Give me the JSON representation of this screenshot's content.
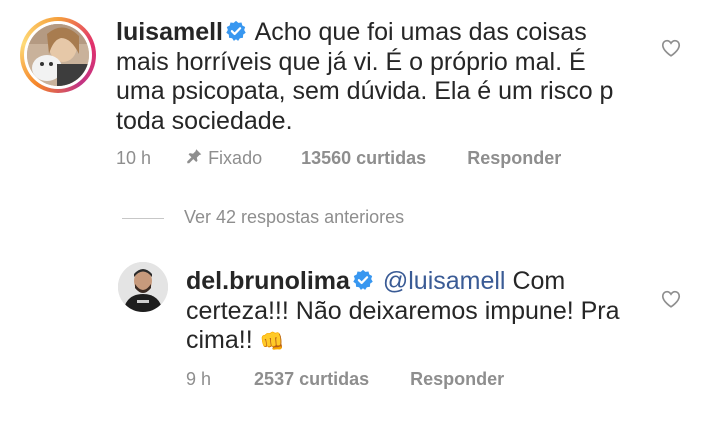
{
  "comment1": {
    "username": "luisamell",
    "text": "Acho que foi umas das coisas mais horríveis que já vi. É o próprio mal. É uma psicopata, sem dúvida. Ela é um risco p toda sociedade.",
    "time": "10 h",
    "pinned_label": "Fixado",
    "likes": "13560 curtidas",
    "reply_label": "Responder"
  },
  "view_replies": "Ver 42 respostas anteriores",
  "reply1": {
    "username": "del.brunolima",
    "mention": "@luisamell",
    "text": "Com certeza!!! Não deixaremos impune! Pra cima!!",
    "emoji": "👊",
    "time": "9 h",
    "likes": "2537 curtidas",
    "reply_label": "Responder"
  },
  "icons": {
    "verified": "verified-badge-icon",
    "pin": "pin-icon",
    "heart": "heart-outline-icon"
  },
  "colors": {
    "verified_blue": "#3897f0",
    "mention_blue": "#3a5b95",
    "meta_gray": "#8e8e8e"
  }
}
